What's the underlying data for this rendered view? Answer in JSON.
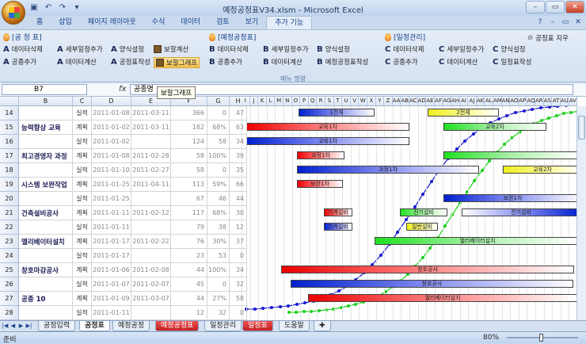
{
  "window": {
    "title": "예정공정표V34.xlsm - Microsoft Excel"
  },
  "ribbon_tabs": [
    "홈",
    "삽입",
    "페이지 레이아웃",
    "수식",
    "데이터",
    "검토",
    "보기",
    "추가 기능"
  ],
  "active_tab_index": 7,
  "ribbon": {
    "groups": [
      {
        "title": "[공 정 표]",
        "items": [
          {
            "letter": "A",
            "label": "데이터삭제"
          },
          {
            "letter": "A",
            "label": "세부일정추가"
          },
          {
            "letter": "A",
            "label": "양식설정"
          },
          {
            "letter": "",
            "label": "보할계산"
          },
          {
            "letter": "A",
            "label": "공종추가"
          },
          {
            "letter": "A",
            "label": "데이터계산"
          },
          {
            "letter": "A",
            "label": "공정표작성"
          },
          {
            "letter": "",
            "label": "보할그래프"
          }
        ]
      },
      {
        "title": "[예정공정표]",
        "items": [
          {
            "letter": "B",
            "label": "데이터삭제"
          },
          {
            "letter": "B",
            "label": "세부일정추가"
          },
          {
            "letter": "B",
            "label": "양식설정"
          },
          {
            "letter": "B",
            "label": "공종추가"
          },
          {
            "letter": "B",
            "label": "데이터계산"
          },
          {
            "letter": "B",
            "label": "예정공정표작성"
          }
        ]
      },
      {
        "title": "[일정관리]",
        "items": [
          {
            "letter": "C",
            "label": "데이터삭제"
          },
          {
            "letter": "C",
            "label": "세부일정추가"
          },
          {
            "letter": "C",
            "label": "양식설정"
          },
          {
            "letter": "C",
            "label": "공종추가"
          },
          {
            "letter": "C",
            "label": "데이터계산"
          },
          {
            "letter": "C",
            "label": "일정표작성"
          }
        ]
      }
    ],
    "extra_button": "공정표 지우",
    "footer": "메뉴 명령"
  },
  "formula_bar": {
    "name_box": "B7",
    "fx": "fx",
    "value": "공종명"
  },
  "tooltip": "보할그래프",
  "columns": [
    "B",
    "C",
    "D",
    "E",
    "F",
    "G",
    "H"
  ],
  "gantt_columns": [
    "I",
    "J",
    "K",
    "L",
    "M",
    "N",
    "O",
    "P",
    "Q",
    "R",
    "S",
    "T",
    "U",
    "V",
    "W",
    "X",
    "Y",
    "Z",
    "AA",
    "AB",
    "AC",
    "AD",
    "AE",
    "AF",
    "AG",
    "AH",
    "AI",
    "AJ",
    "AK",
    "AL",
    "AM",
    "AN",
    "AO",
    "AP",
    "AQ",
    "AR",
    "AS",
    "AT",
    "AU",
    "AV"
  ],
  "rows": [
    {
      "row": "14",
      "task": "",
      "kind": "실적",
      "start": "2011-01-08",
      "end": "2011-03-11",
      "days": "366",
      "pct": "0",
      "w": "47"
    },
    {
      "row": "15",
      "task": "능력향상 교육",
      "kind": "계획",
      "start": "2011-01-02",
      "end": "2011-03-11",
      "days": "182",
      "pct": "68%",
      "w": "63"
    },
    {
      "row": "16",
      "task": "",
      "kind": "실적",
      "start": "2011-01-02",
      "end": "",
      "days": "124",
      "pct": "58",
      "w": "34"
    },
    {
      "row": "17",
      "task": "최고경영자 과정",
      "kind": "계획",
      "start": "2011-01-08",
      "end": "2011-02-28",
      "days": "58",
      "pct": "100%",
      "w": "39"
    },
    {
      "row": "18",
      "task": "",
      "kind": "실적",
      "start": "2011-01-10",
      "end": "2011-02-27",
      "days": "58",
      "pct": "0",
      "w": "35"
    },
    {
      "row": "19",
      "task": "시스템 보완작업",
      "kind": "계획",
      "start": "2011-01-25",
      "end": "2011-04-11",
      "days": "113",
      "pct": "59%",
      "w": "66"
    },
    {
      "row": "20",
      "task": "",
      "kind": "실적",
      "start": "2011-01-25",
      "end": "",
      "days": "67",
      "pct": "46",
      "w": "44"
    },
    {
      "row": "21",
      "task": "건축설비공사",
      "kind": "계획",
      "start": "2011-01-11",
      "end": "2011-02-12",
      "days": "117",
      "pct": "68%",
      "w": "30"
    },
    {
      "row": "22",
      "task": "",
      "kind": "실적",
      "start": "2011-01-11",
      "end": "",
      "days": "79",
      "pct": "38",
      "w": "12"
    },
    {
      "row": "23",
      "task": "엘리베이터설치",
      "kind": "계획",
      "start": "2011-01-17",
      "end": "2011-02-22",
      "days": "76",
      "pct": "30%",
      "w": "37"
    },
    {
      "row": "24",
      "task": "",
      "kind": "실적",
      "start": "2011-01-17",
      "end": "",
      "days": "23",
      "pct": "53",
      "w": "0"
    },
    {
      "row": "25",
      "task": "창호마감공사",
      "kind": "계획",
      "start": "2011-01-06",
      "end": "2011-02-08",
      "days": "44",
      "pct": "100%",
      "w": "34"
    },
    {
      "row": "26",
      "task": "",
      "kind": "실적",
      "start": "2011-01-07",
      "end": "2011-02-07",
      "days": "45",
      "pct": "0",
      "w": "32"
    },
    {
      "row": "27",
      "task": "공종 10",
      "kind": "계획",
      "start": "2011-01-09",
      "end": "2011-03-07",
      "days": "44",
      "pct": "27%",
      "w": "58"
    },
    {
      "row": "28",
      "task": "",
      "kind": "실적",
      "start": "2011-01-11",
      "end": "",
      "days": "12",
      "pct": "32",
      "w": "0"
    }
  ],
  "gantt_bars": [
    {
      "row_index": 0,
      "color": "blue",
      "label": "1전체"
    },
    {
      "row_index": 0,
      "color": "yellow",
      "label": "2전체"
    },
    {
      "row_index": 1,
      "color": "red",
      "label": "교육1차"
    },
    {
      "row_index": 1,
      "color": "green",
      "label": "교육2차"
    },
    {
      "row_index": 2,
      "color": "blue",
      "label": "교육1차"
    },
    {
      "row_index": 3,
      "color": "red",
      "label": "과정1차"
    },
    {
      "row_index": 3,
      "color": "green",
      "label": ""
    },
    {
      "row_index": 4,
      "color": "blue",
      "label": "과정1차"
    },
    {
      "row_index": 4,
      "color": "yellow",
      "label": "교육2차"
    },
    {
      "row_index": 5,
      "color": "red",
      "label": "보완1차"
    },
    {
      "row_index": 6,
      "color": "blue",
      "label": "보완1차"
    },
    {
      "row_index": 7,
      "color": "red",
      "label": "기계설비"
    },
    {
      "row_index": 7,
      "color": "green",
      "label": "전기설비"
    },
    {
      "row_index": 7,
      "color": "blue2",
      "label": "전기설비"
    },
    {
      "row_index": 8,
      "color": "blue",
      "label": "기계설비"
    },
    {
      "row_index": 8,
      "color": "yellow",
      "label": "일반설비"
    },
    {
      "row_index": 9,
      "color": "green",
      "label": "엘리베이터설치"
    },
    {
      "row_index": 11,
      "color": "red",
      "label": "창호공사"
    },
    {
      "row_index": 12,
      "color": "blue",
      "label": "창호공사"
    },
    {
      "row_index": 13,
      "color": "red",
      "label": "엘리베이터설치"
    }
  ],
  "sheet_tabs": [
    {
      "label": "공정입력",
      "active": false,
      "red": false
    },
    {
      "label": "공정표",
      "active": true,
      "red": false
    },
    {
      "label": "예정공정",
      "active": false,
      "red": false
    },
    {
      "label": "예정공정표",
      "active": false,
      "red": true
    },
    {
      "label": "일정관리",
      "active": false,
      "red": false
    },
    {
      "label": "일정표",
      "active": false,
      "red": true
    },
    {
      "label": "도움말",
      "active": false,
      "red": false
    }
  ],
  "status": {
    "ready": "준비",
    "zoom": "80%"
  },
  "colors": {
    "accent": "#15428b",
    "plan_curve": "#1a1ad0",
    "actual_curve": "#20d020"
  }
}
